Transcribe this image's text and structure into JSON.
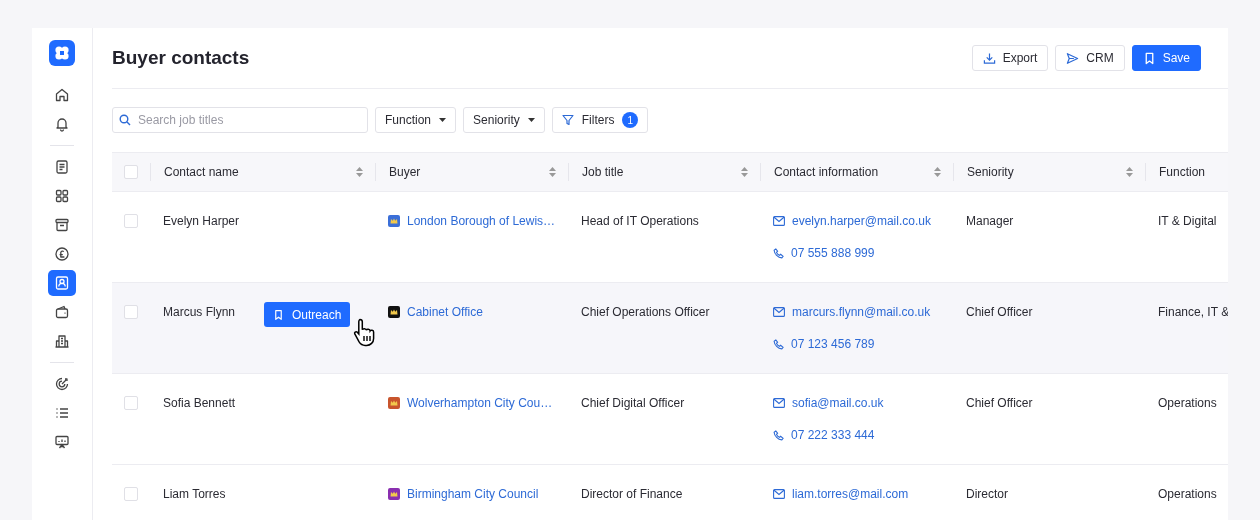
{
  "sidebar": {
    "groups": [
      [
        {
          "selected": false
        },
        {
          "selected": false
        }
      ],
      [
        {
          "selected": false
        },
        {
          "selected": false
        },
        {
          "selected": false
        },
        {
          "selected": false
        },
        {
          "selected": true
        },
        {
          "selected": false
        },
        {
          "selected": false
        }
      ],
      [
        {
          "selected": false
        },
        {
          "selected": false
        },
        {
          "selected": false
        }
      ]
    ]
  },
  "page": {
    "title": "Buyer contacts",
    "actions": [
      {
        "label": "Export",
        "kind": "export",
        "primary": false
      },
      {
        "label": "CRM",
        "kind": "crm",
        "primary": false
      },
      {
        "label": "Save",
        "kind": "save",
        "primary": true
      }
    ]
  },
  "toolbar": {
    "search": {
      "placeholder": "Search job titles"
    },
    "dropdowns": [
      "Function",
      "Seniority"
    ],
    "filters": {
      "label": "Filters",
      "count": "1"
    }
  },
  "table": {
    "select_all": {
      "checked": false
    },
    "columns": [
      {
        "label": "Contact name",
        "sortable": true
      },
      {
        "label": "Buyer",
        "sortable": true
      },
      {
        "label": "Job title",
        "sortable": true
      },
      {
        "label": "Contact information",
        "sortable": true
      },
      {
        "label": "Seniority",
        "sortable": true
      },
      {
        "label": "Function",
        "sortable": false
      }
    ],
    "rows": [
      {
        "checked": false,
        "hovered": false,
        "name": "Evelyn Harper",
        "buyer": {
          "name": "London Borough of Lewis…",
          "color": "#3b6fd8"
        },
        "job_title": "Head of IT Operations",
        "email": "evelyn.harper@mail.co.uk",
        "phone": "07 555 888 999",
        "seniority": "Manager",
        "function": "IT & Digital"
      },
      {
        "checked": false,
        "hovered": true,
        "action": "Outreach",
        "name": "Marcus Flynn",
        "buyer": {
          "name": "Cabinet Office",
          "color": "#111111"
        },
        "job_title": "Chief Operations Officer",
        "email": "marcurs.flynn@mail.co.uk",
        "phone": "07 123 456 789",
        "seniority": "Chief Officer",
        "function": "Finance, IT &"
      },
      {
        "checked": false,
        "hovered": false,
        "name": "Sofia Bennett",
        "buyer": {
          "name": "Wolverhampton City Cou…",
          "color": "#c8552d"
        },
        "job_title": "Chief Digital Officer",
        "email": "sofia@mail.co.uk",
        "phone": "07 222 333 444",
        "seniority": "Chief Officer",
        "function": "Operations"
      },
      {
        "checked": false,
        "hovered": false,
        "name": "Liam Torres",
        "buyer": {
          "name": "Birmingham City Council",
          "color": "#8a2fb0"
        },
        "job_title": "Director of Finance",
        "email": "liam.torres@mail.com",
        "seniority": "Director",
        "function": "Operations"
      }
    ]
  }
}
